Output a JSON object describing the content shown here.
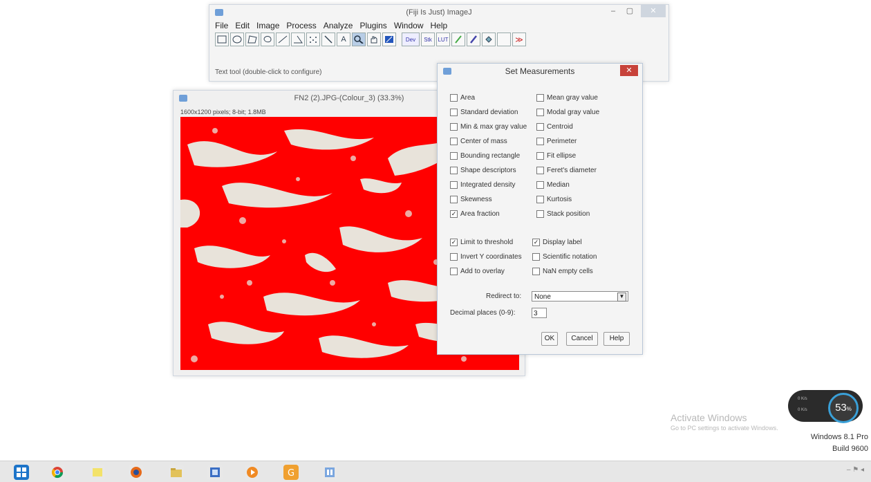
{
  "imagej": {
    "title": "(Fiji Is Just) ImageJ",
    "menu": [
      "File",
      "Edit",
      "Image",
      "Process",
      "Analyze",
      "Plugins",
      "Window",
      "Help"
    ],
    "status": "Text tool (double-click to configure)",
    "tool_text_label": "A",
    "tool_dev": "Dev",
    "tool_stk": "Stk",
    "tool_lut": "LUT",
    "tool_more": "≫",
    "minimize": "–",
    "maximize": "▢",
    "close": "✕"
  },
  "image_window": {
    "title": "FN2 (2).JPG-(Colour_3) (33.3%)",
    "info": "1600x1200 pixels; 8-bit; 1.8MB"
  },
  "dialog": {
    "title": "Set Measurements",
    "close": "✕",
    "left_checks": [
      {
        "label": "Area",
        "checked": false
      },
      {
        "label": "Standard deviation",
        "checked": false
      },
      {
        "label": "Min & max gray value",
        "checked": false
      },
      {
        "label": "Center of mass",
        "checked": false
      },
      {
        "label": "Bounding rectangle",
        "checked": false
      },
      {
        "label": "Shape descriptors",
        "checked": false
      },
      {
        "label": "Integrated density",
        "checked": false
      },
      {
        "label": "Skewness",
        "checked": false
      },
      {
        "label": "Area fraction",
        "checked": true
      }
    ],
    "right_checks": [
      {
        "label": "Mean gray value",
        "checked": false
      },
      {
        "label": "Modal gray value",
        "checked": false
      },
      {
        "label": "Centroid",
        "checked": false
      },
      {
        "label": "Perimeter",
        "checked": false
      },
      {
        "label": "Fit ellipse",
        "checked": false
      },
      {
        "label": "Feret's diameter",
        "checked": false
      },
      {
        "label": "Median",
        "checked": false
      },
      {
        "label": "Kurtosis",
        "checked": false
      },
      {
        "label": "Stack position",
        "checked": false
      }
    ],
    "opt_left": [
      {
        "label": "Limit to threshold",
        "checked": true
      },
      {
        "label": "Invert Y coordinates",
        "checked": false
      },
      {
        "label": "Add to overlay",
        "checked": false
      }
    ],
    "opt_right": [
      {
        "label": "Display label",
        "checked": true
      },
      {
        "label": "Scientific notation",
        "checked": false
      },
      {
        "label": "NaN empty cells",
        "checked": false
      }
    ],
    "redirect_label": "Redirect to:",
    "redirect_value": "None",
    "decimal_label": "Decimal places (0-9):",
    "decimal_value": "3",
    "ok": "OK",
    "cancel": "Cancel",
    "help": "Help"
  },
  "desktop": {
    "activate_title": "Activate Windows",
    "activate_sub": "Go to PC settings to activate Windows.",
    "os_name": "Windows 8.1 Pro",
    "os_build": "Build 9600",
    "gauge_value": "53",
    "gauge_unit": "%",
    "gauge_row1": "0 K/s",
    "gauge_row2": "0 K/s"
  },
  "colors": {
    "threshold_red": "#ff0000",
    "tissue_bg": "#e8e3da",
    "close_red": "#c7423a"
  }
}
